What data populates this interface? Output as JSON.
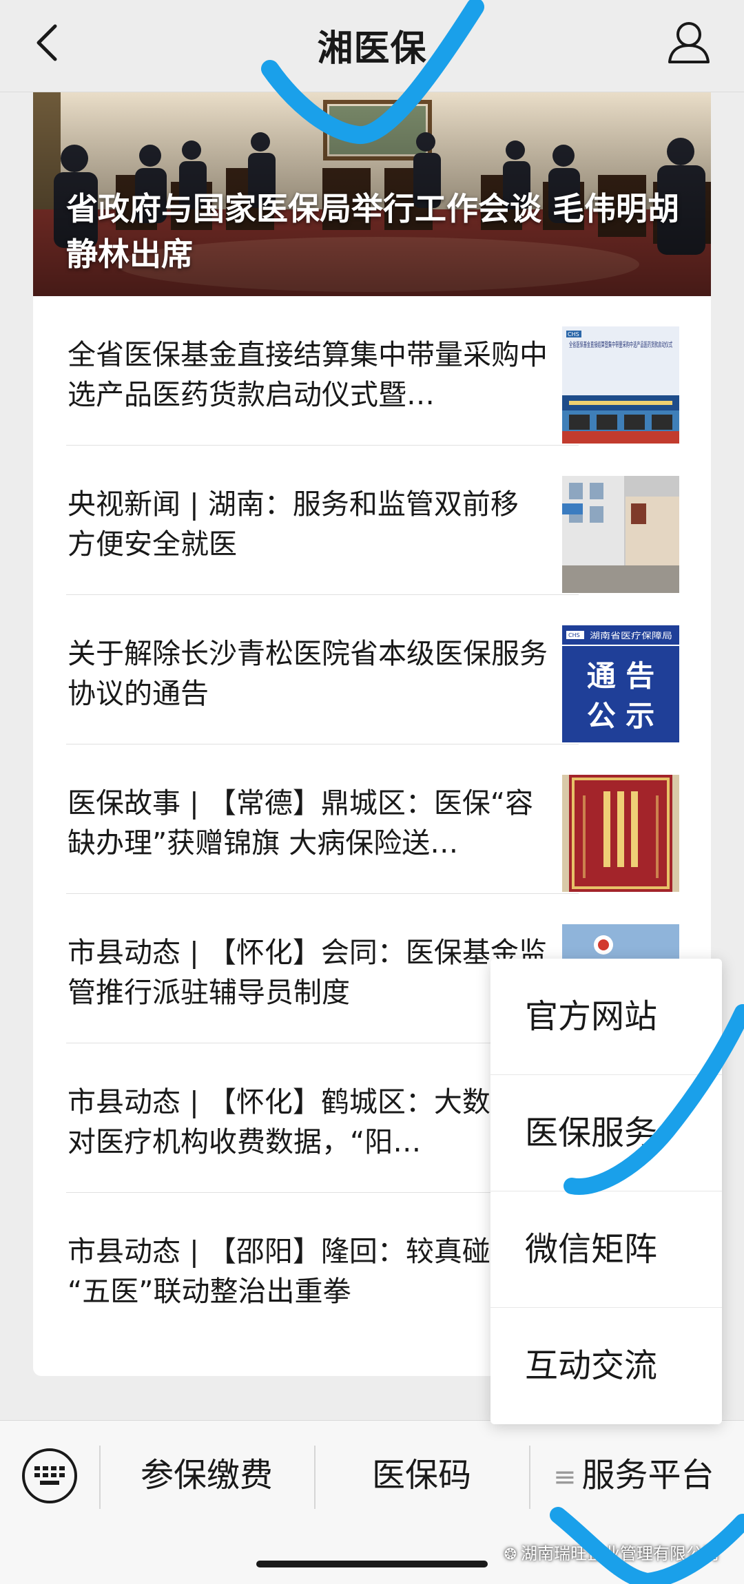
{
  "header": {
    "title": "湘医保"
  },
  "banner": {
    "title": "省政府与国家医保局举行工作会谈 毛伟明胡静林出席"
  },
  "articles": [
    {
      "title": "全省医保基金直接结算集中带量采购中选产品医药货款启动仪式暨…",
      "thumb_caption": "全省医保基金直接结算暨集中带量采购中选产品医药货款启动仪式",
      "thumb_logo": "CHS"
    },
    {
      "title": "央视新闻 | 湖南：服务和监管双前移 方便安全就医"
    },
    {
      "title": "关于解除长沙青松医院省本级医保服务协议的通告",
      "thumb_logo": "CHS",
      "thumb_org": "湖南省医疗保障局",
      "thumb_line1": "通 告",
      "thumb_line2": "公 示"
    },
    {
      "title": "医保故事 | 【常德】鼎城区：医保“容缺办理”获赠锦旗 大病保险送…"
    },
    {
      "title": "市县动态 | 【怀化】会同：医保基金监管推行派驻辅导员制度"
    },
    {
      "title": "市县动态 | 【怀化】鹤城区：大数据比对医疗机构收费数据，“阳…"
    },
    {
      "title": "市县动态 | 【邵阳】隆回：较真碰硬 “五医”联动整治出重拳"
    }
  ],
  "popup": {
    "items": [
      "官方网站",
      "医保服务",
      "微信矩阵",
      "互动交流"
    ]
  },
  "bottom_menu": {
    "items": [
      "参保缴费",
      "医保码",
      "服务平台"
    ]
  },
  "watermark": {
    "text": "湖南瑞旺企业管理有限公司"
  }
}
